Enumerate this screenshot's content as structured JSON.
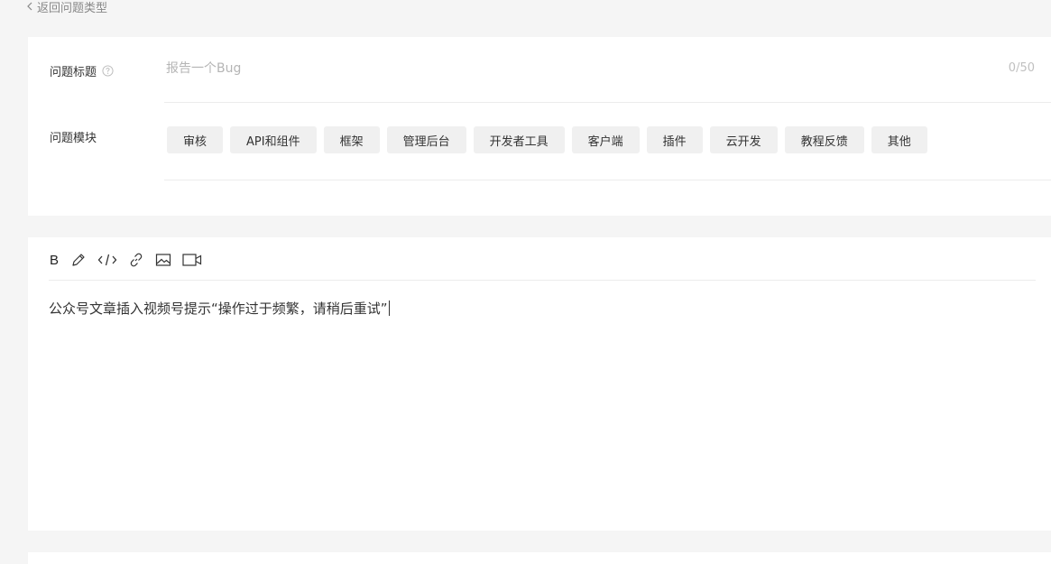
{
  "back_link": {
    "icon": "chevron-left-icon",
    "label": "返回问题类型"
  },
  "form": {
    "title_field": {
      "label": "问题标题",
      "help_icon": "question-circle-icon",
      "placeholder": "报告一个Bug",
      "value": "",
      "char_count": "0/50"
    },
    "module_field": {
      "label": "问题模块",
      "options": [
        {
          "label": "审核"
        },
        {
          "label": "API和组件"
        },
        {
          "label": "框架"
        },
        {
          "label": "管理后台"
        },
        {
          "label": "开发者工具"
        },
        {
          "label": "客户端"
        },
        {
          "label": "插件"
        },
        {
          "label": "云开发"
        },
        {
          "label": "教程反馈"
        },
        {
          "label": "其他"
        }
      ]
    }
  },
  "editor": {
    "toolbar": [
      {
        "name": "bold",
        "label": "B"
      },
      {
        "name": "pen-icon"
      },
      {
        "name": "code-icon"
      },
      {
        "name": "link-icon"
      },
      {
        "name": "image-icon"
      },
      {
        "name": "video-icon"
      }
    ],
    "content": "公众号文章插入视频号提示“操作过于频繁，请稍后重试”"
  }
}
